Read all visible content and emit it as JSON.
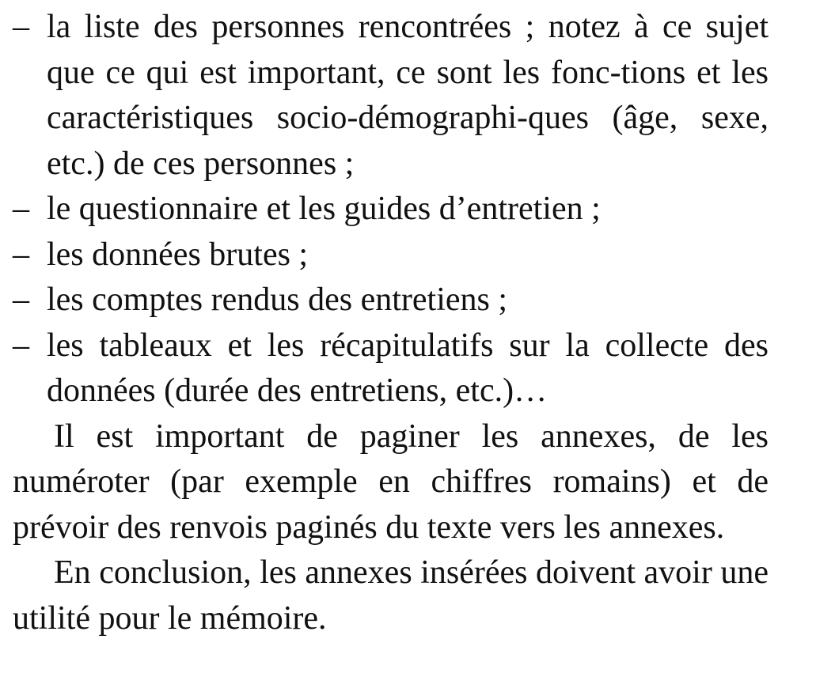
{
  "list": {
    "items": [
      {
        "marker": "–",
        "text": "la liste des personnes rencontrées ; notez à ce sujet que ce qui est important, ce sont les fonc-tions et les caractéristiques socio-démographi-ques (âge, sexe, etc.) de ces personnes ;"
      },
      {
        "marker": "–",
        "text": "le questionnaire et les guides d’entretien ;"
      },
      {
        "marker": "–",
        "text": "les données brutes ;"
      },
      {
        "marker": "–",
        "text": "les comptes rendus des entretiens ;"
      },
      {
        "marker": "–",
        "text": "les tableaux et les récapitulatifs sur la collecte des données (durée des entretiens, etc.)…"
      }
    ]
  },
  "paragraphs": [
    "Il est important de paginer les annexes, de les numéroter (par exemple en chiffres romains) et de prévoir des renvois paginés du texte vers les annexes.",
    "En conclusion, les annexes insérées doivent avoir une utilité pour le mémoire."
  ]
}
